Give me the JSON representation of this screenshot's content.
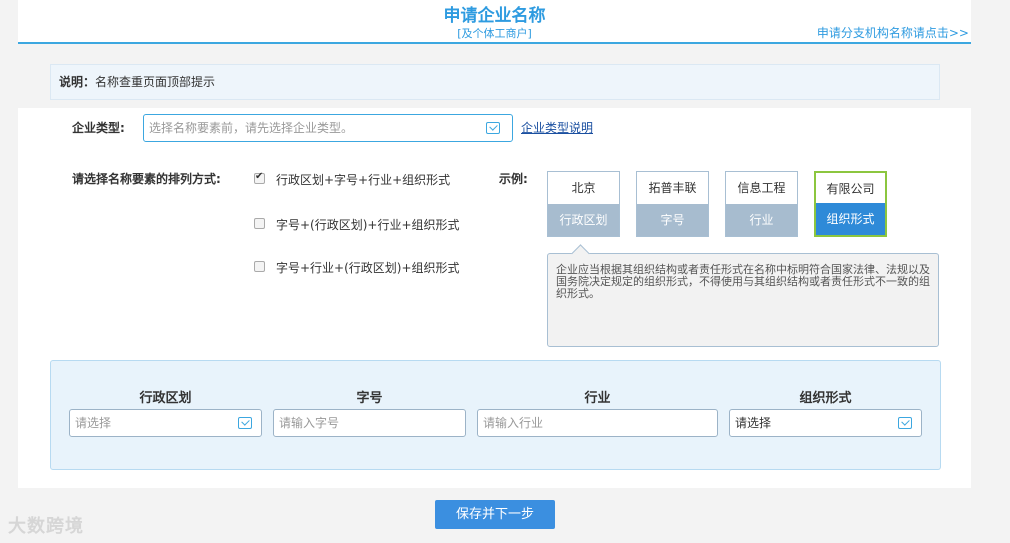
{
  "header": {
    "title": "申请企业名称",
    "subtitle": "[及个体工商户]",
    "branch_link": "申请分支机构名称请点击>>"
  },
  "note": {
    "label": "说明：",
    "text": "名称查重页面顶部提示"
  },
  "company_type": {
    "label": "企业类型:",
    "placeholder": "选择名称要素前，请先选择企业类型。",
    "link": "企业类型说明"
  },
  "arrangement": {
    "label": "请选择名称要素的排列方式:",
    "options": [
      {
        "text": "行政区划+字号+行业+组织形式",
        "checked": true
      },
      {
        "text": "字号+(行政区划)+行业+组织形式",
        "checked": false
      },
      {
        "text": "字号+行业+(行政区划)+组织形式",
        "checked": false
      }
    ]
  },
  "example": {
    "label": "示例:",
    "boxes": [
      {
        "value": "北京",
        "caption": "行政区划"
      },
      {
        "value": "拓普丰联",
        "caption": "字号"
      },
      {
        "value": "信息工程",
        "caption": "行业"
      },
      {
        "value": "有限公司",
        "caption": "组织形式"
      }
    ],
    "description": "企业应当根据其组织结构或者责任形式在名称中标明符合国家法律、法规以及国务院决定规定的组织形式，不得使用与其组织结构或者责任形式不一致的组织形式。"
  },
  "compose": {
    "columns": [
      {
        "label": "行政区划",
        "placeholder": "请选择"
      },
      {
        "label": "字号",
        "placeholder": "请输入字号"
      },
      {
        "label": "行业",
        "placeholder": "请输入行业"
      },
      {
        "label": "组织形式",
        "value": "请选择"
      }
    ]
  },
  "actions": {
    "save_next": "保存并下一步"
  },
  "watermark": "大数跨境",
  "colors": {
    "accent": "#2e9be0",
    "active_caption": "#2e8ad8",
    "active_border": "#8cc63f",
    "button": "#3b8fe0"
  }
}
